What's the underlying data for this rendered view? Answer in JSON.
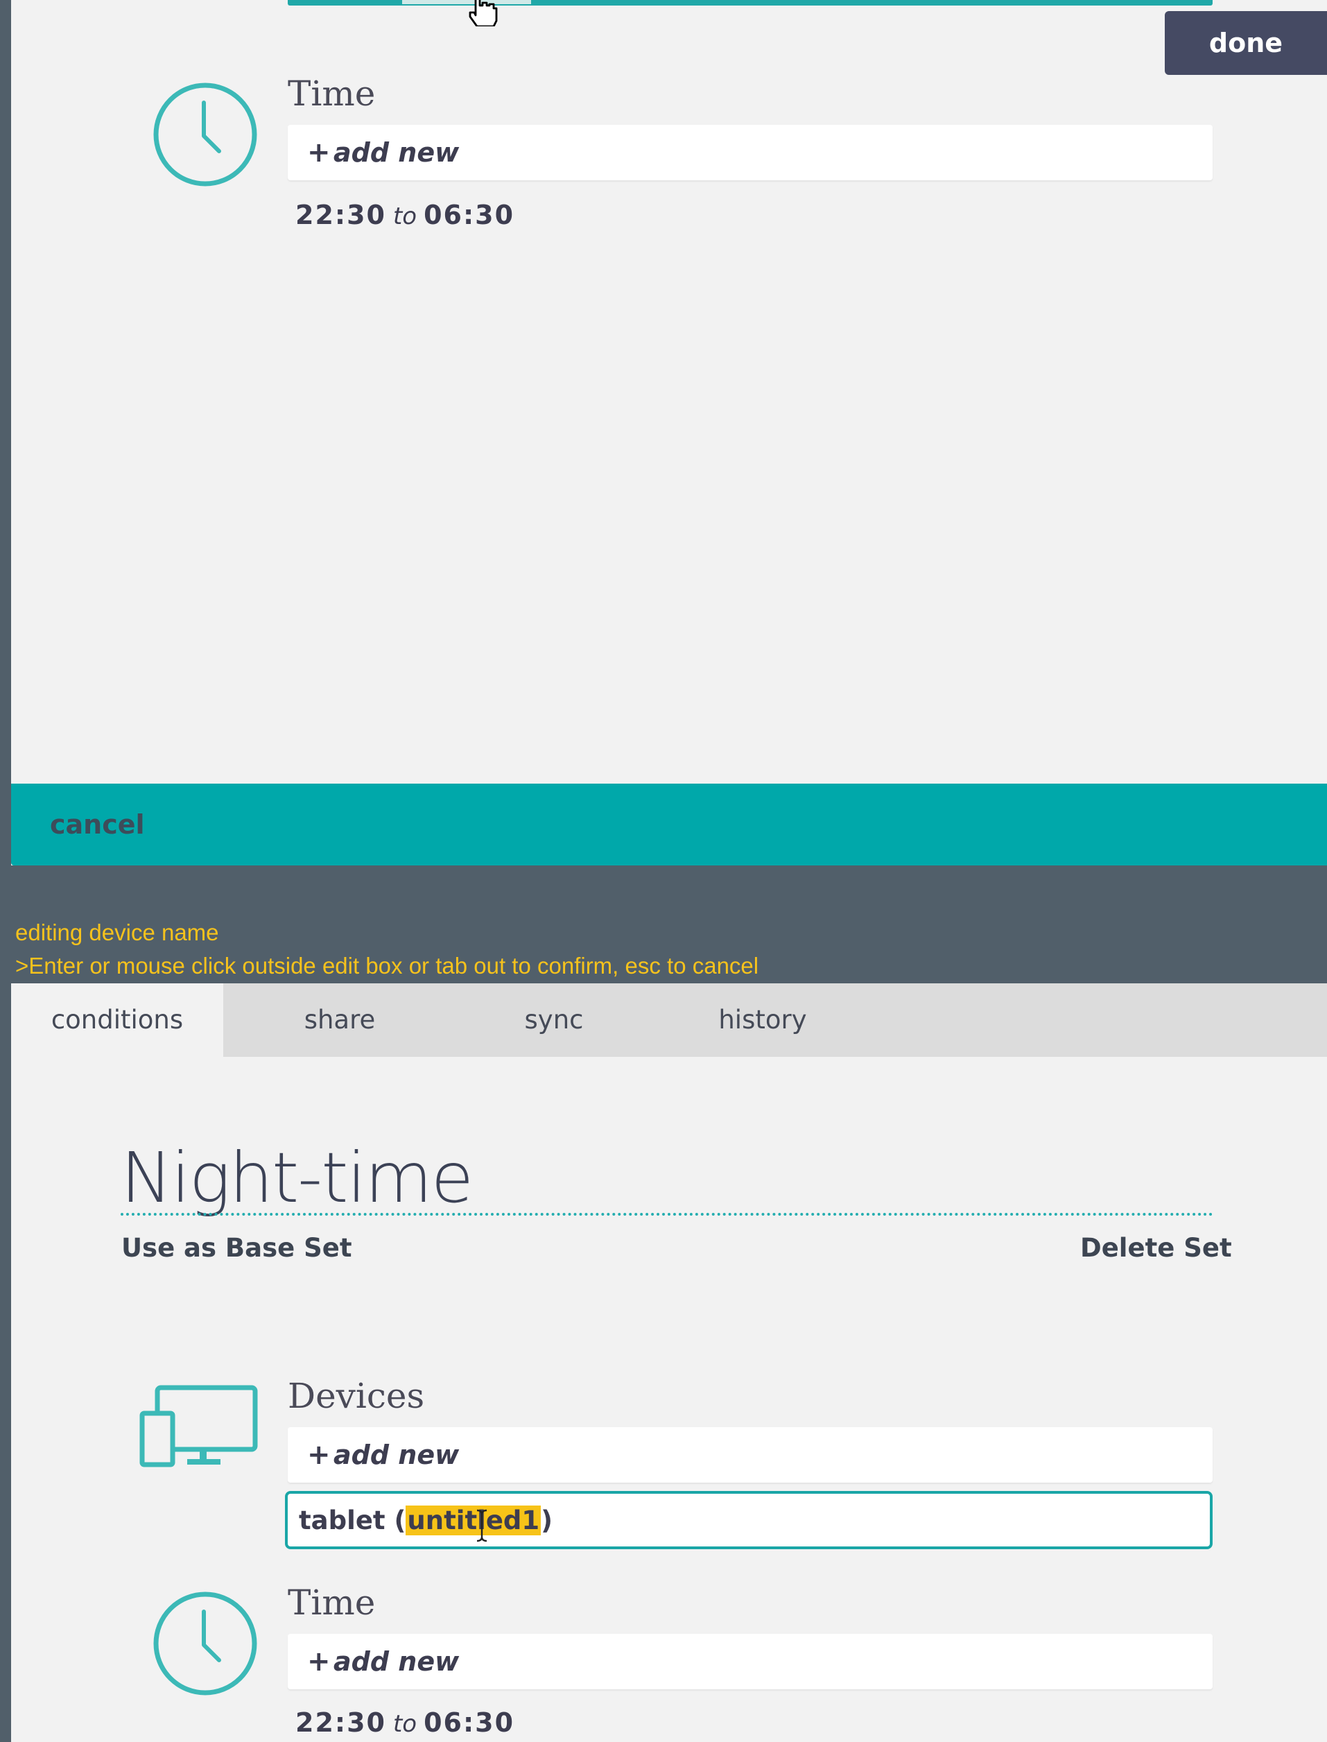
{
  "colors": {
    "teal": "#00a8aa",
    "accent_line": "#20a8a8",
    "done_button": "#454a63",
    "status_text": "#f6c21c",
    "selection_highlight": "#f7c318",
    "dark_frame": "#515f6a",
    "panel_bg": "#f2f2f2"
  },
  "icons": {
    "clock": "clock-icon",
    "devices": "devices-icon",
    "plus": "plus-icon",
    "pointer_cursor": "hand-pointer-cursor",
    "text_cursor": "i-beam-cursor"
  },
  "top_panel": {
    "time_section": {
      "title": "Time",
      "add_plus": "+",
      "add_label": "add new",
      "range_start": "22:30",
      "range_to": "to",
      "range_end": "06:30"
    },
    "actions": {
      "cancel_label": "cancel",
      "done_label": "done"
    }
  },
  "status": {
    "line1": "editing device name",
    "line2": ">Enter or mouse click outside edit box or tab out to confirm, esc to cancel"
  },
  "tabs": [
    {
      "label": "conditions",
      "active": true
    },
    {
      "label": "share",
      "active": false
    },
    {
      "label": "sync",
      "active": false
    },
    {
      "label": "history",
      "active": false
    }
  ],
  "set": {
    "title": "Night-time",
    "use_as_base_label": "Use as Base Set",
    "delete_label": "Delete Set"
  },
  "devices_section": {
    "title": "Devices",
    "add_plus": "+",
    "add_label": "add new",
    "edit_value_prefix": "tablet (",
    "edit_value_selected": "untitled1",
    "edit_value_suffix": ")"
  },
  "time_section_bottom": {
    "title": "Time",
    "add_plus": "+",
    "add_label": "add new",
    "range_start": "22:30",
    "range_to": "to",
    "range_end": "06:30"
  }
}
